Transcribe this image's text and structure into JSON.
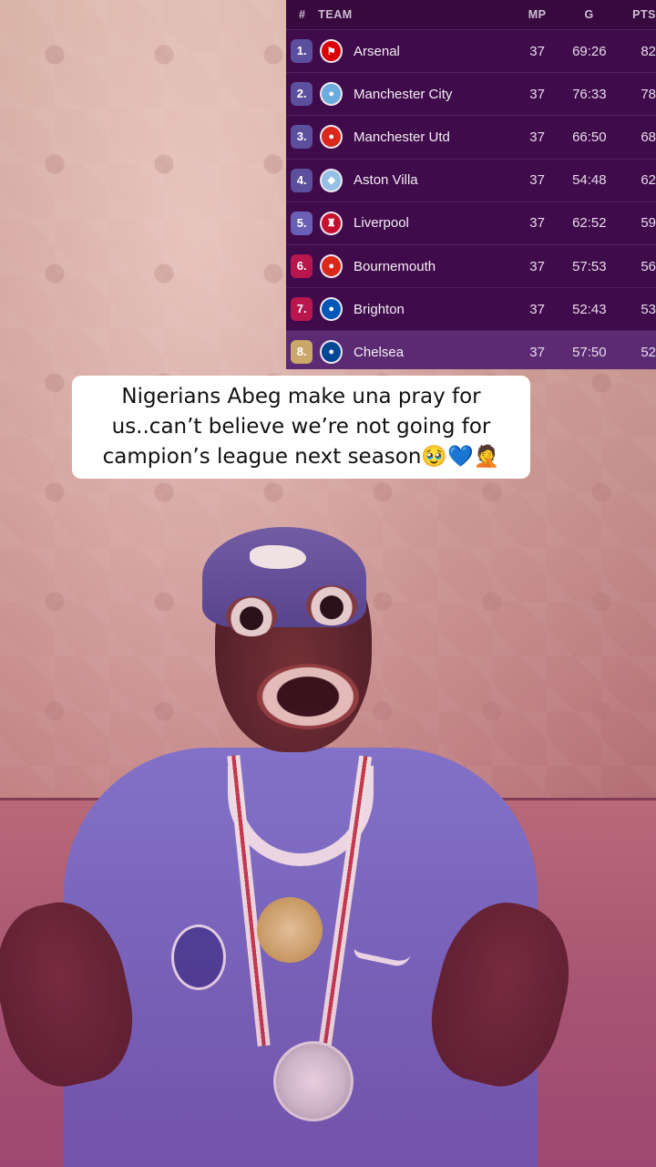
{
  "standings": {
    "headers": {
      "num": "#",
      "team": "TEAM",
      "mp": "MP",
      "g": "G",
      "pts": "PTS"
    },
    "rows": [
      {
        "pos": "1.",
        "team": "Arsenal",
        "mp": "37",
        "g": "69:26",
        "pts": "82",
        "pos_color": "#5b4f9e",
        "badge_color": "#db0007",
        "badge_glyph": "⚑"
      },
      {
        "pos": "2.",
        "team": "Manchester City",
        "mp": "37",
        "g": "76:33",
        "pts": "78",
        "pos_color": "#5b4f9e",
        "badge_color": "#6cabdd",
        "badge_glyph": "●"
      },
      {
        "pos": "3.",
        "team": "Manchester Utd",
        "mp": "37",
        "g": "66:50",
        "pts": "68",
        "pos_color": "#5b4f9e",
        "badge_color": "#da291c",
        "badge_glyph": "●"
      },
      {
        "pos": "4.",
        "team": "Aston Villa",
        "mp": "37",
        "g": "54:48",
        "pts": "62",
        "pos_color": "#5b4f9e",
        "badge_color": "#95bfe5",
        "badge_glyph": "◆"
      },
      {
        "pos": "5.",
        "team": "Liverpool",
        "mp": "37",
        "g": "62:52",
        "pts": "59",
        "pos_color": "#6a5fb6",
        "badge_color": "#c8102e",
        "badge_glyph": "♜"
      },
      {
        "pos": "6.",
        "team": "Bournemouth",
        "mp": "37",
        "g": "57:53",
        "pts": "56",
        "pos_color": "#b8174e",
        "badge_color": "#da291c",
        "badge_glyph": "●"
      },
      {
        "pos": "7.",
        "team": "Brighton",
        "mp": "37",
        "g": "52:43",
        "pts": "53",
        "pos_color": "#b8174e",
        "badge_color": "#0057b8",
        "badge_glyph": "●"
      },
      {
        "pos": "8.",
        "team": "Chelsea",
        "mp": "37",
        "g": "57:50",
        "pts": "52",
        "pos_color": "#c9a86a",
        "badge_color": "#034694",
        "badge_glyph": "●",
        "highlight": true
      }
    ]
  },
  "caption": {
    "text": "Nigerians Abeg make una pray for us..can’t believe we’re not going for campion’s league next season🥹💙🤦"
  }
}
